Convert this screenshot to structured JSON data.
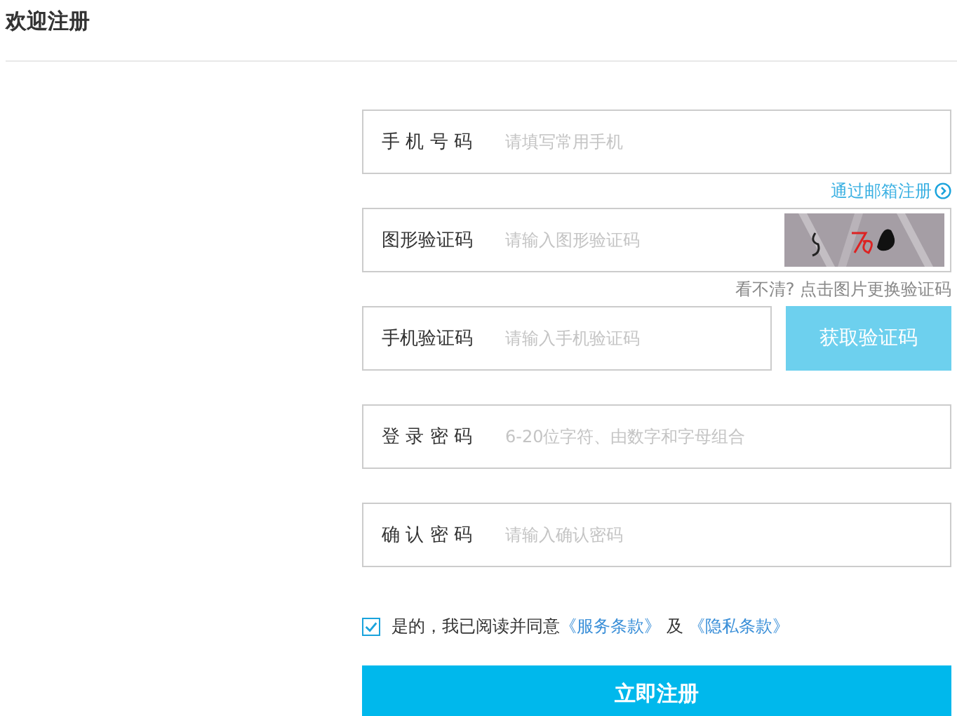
{
  "header": {
    "title": "欢迎注册"
  },
  "fields": [
    {
      "kind": "text",
      "label": "手 机 号 码",
      "placeholder": "请填写常用手机",
      "note": {
        "text": "通过邮箱注册",
        "kind": "link"
      }
    },
    {
      "kind": "captcha",
      "label": "图形验证码",
      "placeholder": "请输入图形验证码",
      "note": {
        "text": "看不清? 点击图片更换验证码",
        "kind": "hint"
      }
    },
    {
      "kind": "sms",
      "label": "手机验证码",
      "placeholder": "请输入手机验证码",
      "button": "获取验证码"
    },
    {
      "kind": "text",
      "label": "登 录 密 码",
      "placeholder": "6-20位字符、由数字和字母组合"
    },
    {
      "kind": "text",
      "label": "确 认 密 码",
      "placeholder": "请输入确认密码"
    }
  ],
  "agreement": {
    "checked": true,
    "text": "是的，我已阅读并同意",
    "terms_link": "《服务条款》",
    "joiner": "及",
    "privacy_link": "《隐私条款》"
  },
  "submit": "立即注册"
}
